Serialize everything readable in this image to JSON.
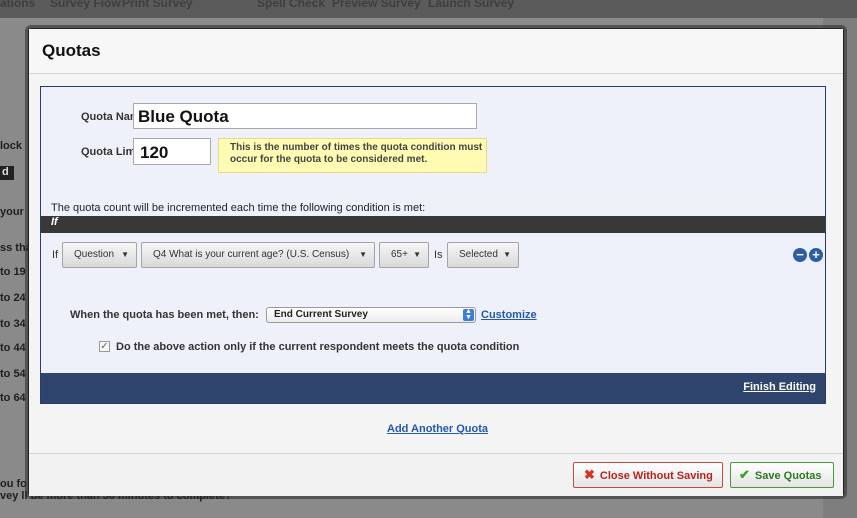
{
  "background": {
    "toolbar": [
      "ations",
      "Survey Flow",
      "Print Survey",
      "Spell Check",
      "Preview Survey",
      "Launch Survey"
    ],
    "sidebar": [
      "lock",
      "d",
      "your",
      "ss tha",
      "to 19",
      "to 24",
      "to 34",
      "to 44",
      "to 54",
      "to 64"
    ],
    "footer_line1": "ou fo",
    "footer_line2": "vey                                  ll be more than 30 minutes to complete?"
  },
  "modal": {
    "title": "Quotas",
    "quota_name_label": "Quota Name:",
    "quota_name_value": "Blue Quota",
    "quota_limit_label": "Quota Limit:",
    "quota_limit_value": "120",
    "limit_tip": "This is the number of times the quota condition must occur for the quota to be considered met.",
    "condition_intro": "The quota count will be incremented each time the following condition is met:",
    "if_bar": "If",
    "condition": {
      "if_word": "If",
      "type": "Question",
      "question": "Q4 What is your current age? (U.S. Census)",
      "choice": "65+",
      "is_word": "Is",
      "state": "Selected",
      "remove_symbol": "−",
      "add_symbol": "+"
    },
    "action_label": "When the quota has been met, then:",
    "action_value": "End Current Survey",
    "customize": "Customize",
    "checkbox_label": "Do the above action only if the current respondent meets the quota condition",
    "checkbox_checked": true,
    "finish_editing": "Finish Editing",
    "add_another": "Add Another Quota",
    "close_button": "Close Without Saving",
    "save_button": "Save Quotas"
  },
  "colors": {
    "link": "#2357b0",
    "finish_bar": "#2f456d",
    "tip_background": "#fffbb3",
    "close_red": "#b8241c",
    "save_green": "#2d7a23"
  }
}
